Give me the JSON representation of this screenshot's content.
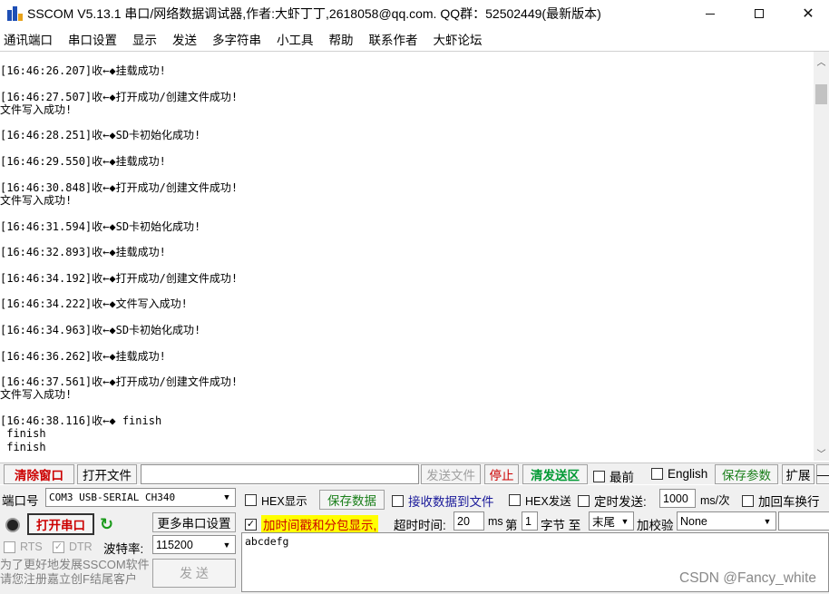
{
  "window": {
    "title": "SSCOM V5.13.1 串口/网络数据调试器,作者:大虾丁丁,2618058@qq.com. QQ群：52502449(最新版本)",
    "min_glyph": "—",
    "close_glyph": "✕"
  },
  "menu": [
    "通讯端口",
    "串口设置",
    "显示",
    "发送",
    "多字符串",
    "小工具",
    "帮助",
    "联系作者",
    "大虾论坛"
  ],
  "receive": {
    "lines": [
      "[16:46:26.207]收←◆挂载成功!",
      "",
      "[16:46:27.507]收←◆打开成功/创建文件成功!",
      "文件写入成功!",
      "",
      "[16:46:28.251]收←◆SD卡初始化成功!",
      "",
      "[16:46:29.550]收←◆挂载成功!",
      "",
      "[16:46:30.848]收←◆打开成功/创建文件成功!",
      "文件写入成功!",
      "",
      "[16:46:31.594]收←◆SD卡初始化成功!",
      "",
      "[16:46:32.893]收←◆挂载成功!",
      "",
      "[16:46:34.192]收←◆打开成功/创建文件成功!",
      "",
      "[16:46:34.222]收←◆文件写入成功!",
      "",
      "[16:46:34.963]收←◆SD卡初始化成功!",
      "",
      "[16:46:36.262]收←◆挂载成功!",
      "",
      "[16:46:37.561]收←◆打开成功/创建文件成功!",
      "文件写入成功!",
      "",
      "[16:46:38.116]收←◆ finish",
      " finish",
      " finish"
    ]
  },
  "toolbar": {
    "clear_window": "清除窗口",
    "open_file": "打开文件",
    "file_path": "",
    "send_file": "发送文件",
    "stop": "停止",
    "clear_send": "清发送区",
    "frontmost": "最前",
    "english": "English",
    "save_params": "保存参数",
    "expand": "扩展",
    "dash": "—"
  },
  "port": {
    "port_label": "端口号",
    "port_value": "COM3 USB-SERIAL CH340",
    "open_port": "打开串口",
    "more_settings": "更多串口设置",
    "rts": "RTS",
    "dtr": "DTR",
    "baud_label": "波特率:",
    "baud_value": "115200"
  },
  "options": {
    "hex_display": "HEX显示",
    "save_data": "保存数据",
    "recv_to_file": "接收数据到文件",
    "hex_send": "HEX发送",
    "timed_send": "定时发送:",
    "timed_value": "1000",
    "timed_unit": "ms/次",
    "add_crlf": "加回车换行",
    "timestamp": "加时间戳和分包显示,",
    "timeout_label": "超时时间:",
    "timeout_value": "20",
    "timeout_unit": "ms",
    "byte_label_a": "第",
    "byte_value": "1",
    "byte_label_b": "字节 至",
    "end_value": "末尾",
    "checksum_label": "加校验",
    "checksum_value": "None"
  },
  "send": {
    "text": "abcdefg",
    "button": "发 送",
    "promo_line1": "为了更好地发展SSCOM软件",
    "promo_line2": "请您注册嘉立创F结尾客户"
  },
  "watermark": "CSDN @Fancy_white"
}
